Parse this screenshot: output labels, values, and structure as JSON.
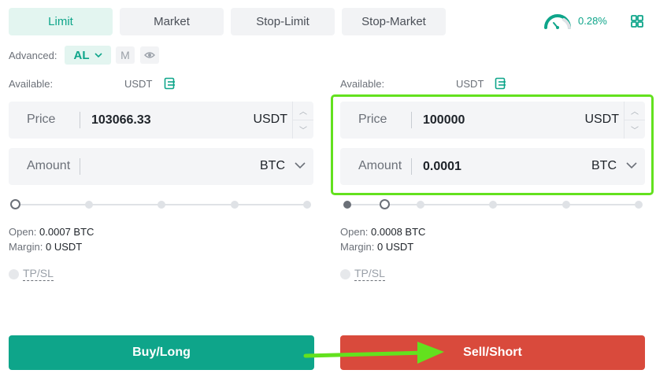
{
  "tabs": [
    {
      "label": "Limit",
      "active": true
    },
    {
      "label": "Market",
      "active": false
    },
    {
      "label": "Stop-Limit",
      "active": false
    },
    {
      "label": "Stop-Market",
      "active": false
    }
  ],
  "header": {
    "funding_rate": "0.28%",
    "gauge_icon": "gauge-icon",
    "grid_icon": "grid-icon"
  },
  "advanced": {
    "label": "Advanced:",
    "mode": "AL",
    "m_label": "M",
    "eye_icon": "eye-icon"
  },
  "left": {
    "available_label": "Available:",
    "available_unit": "USDT",
    "price_label": "Price",
    "price_value": "103066.33",
    "price_unit": "USDT",
    "amount_label": "Amount",
    "amount_value": "",
    "amount_unit": "BTC",
    "open_label": "Open:",
    "open_value": "0.0007 BTC",
    "margin_label": "Margin:",
    "margin_value": "0 USDT",
    "tpsl_label": "TP/SL",
    "action_label": "Buy/Long"
  },
  "right": {
    "available_label": "Available:",
    "available_unit": "USDT",
    "price_label": "Price",
    "price_value": "100000",
    "price_unit": "USDT",
    "amount_label": "Amount",
    "amount_value": "0.0001",
    "amount_unit": "BTC",
    "open_label": "Open:",
    "open_value": "0.0008 BTC",
    "margin_label": "Margin:",
    "margin_value": "0 USDT",
    "tpsl_label": "TP/SL",
    "action_label": "Sell/Short"
  },
  "colors": {
    "accent": "#0ea58a",
    "sell": "#d94a3c",
    "annotation": "#63e11e"
  }
}
